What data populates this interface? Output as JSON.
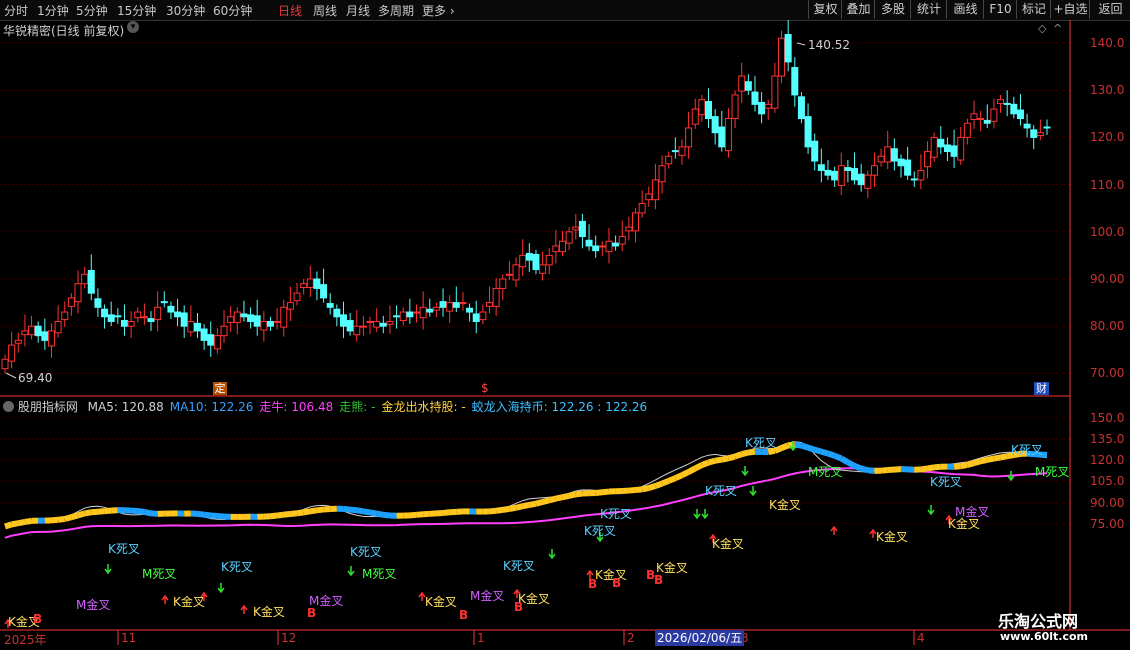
{
  "topbar": {
    "periods": [
      "分时",
      "1分钟",
      "5分钟",
      "15分钟",
      "30分钟",
      "60分钟",
      "日线",
      "周线",
      "月线",
      "多周期",
      "更多"
    ],
    "active_period": "日线",
    "right_buttons": [
      "复权",
      "叠加",
      "多股",
      "统计",
      "画线",
      "F10",
      "标记",
      "+自选",
      "返回"
    ]
  },
  "main_panel": {
    "title": "华锐精密(日线 前复权)",
    "price_high_label": "140.52",
    "price_low_label": "69.40",
    "y_ticks": [
      "140.0",
      "130.0",
      "120.0",
      "110.0",
      "100.0",
      "90.00",
      "80.00",
      "70.00"
    ],
    "markers": [
      "定",
      "$",
      "财"
    ]
  },
  "indicator_panel": {
    "name": "股朋指标网",
    "legend": [
      {
        "label": "MA5: 120.88",
        "color": "#d0d0d0"
      },
      {
        "label": "MA10: 122.26",
        "color": "#3aa0ff"
      },
      {
        "label": "走牛: 106.48",
        "color": "#ff40ff"
      },
      {
        "label": "走熊: -",
        "color": "#30c030"
      },
      {
        "label": "金龙出水持股: -",
        "color": "#ffd040"
      },
      {
        "label": "蛟龙入海持币: 122.26 : 122.26",
        "color": "#40c0ff"
      }
    ],
    "y_ticks": [
      "150.0",
      "135.0",
      "120.0",
      "105.0",
      "90.00",
      "75.00"
    ],
    "signal_labels": {
      "k_death": "K死叉",
      "k_golden": "K金叉",
      "m_death": "M死叉",
      "m_golden": "M金叉",
      "buy": "B"
    }
  },
  "date_axis": {
    "labels": [
      "2025年",
      "11",
      "12",
      "1",
      "2",
      "3",
      "4"
    ],
    "cursor_date": "2026/02/06/五"
  },
  "watermark": {
    "title": "乐淘公式网",
    "url": "www.60lt.com"
  },
  "colors": {
    "up": "#ff3232",
    "down": "#54ffff",
    "grid": "#5a0000",
    "axis_text": "#c83232",
    "ma10_down": "#1ea0ff",
    "ma10_up": "#ffc61e",
    "bull_line": "#ff40ff"
  }
}
